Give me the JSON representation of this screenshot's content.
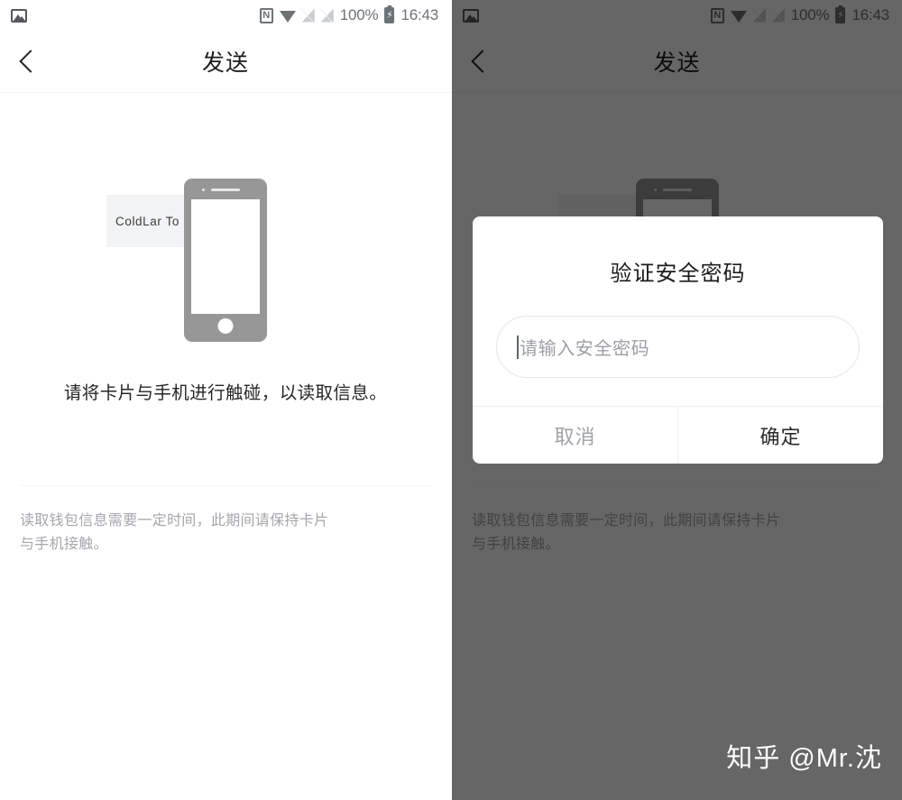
{
  "status_bar": {
    "notification_icon": "photo-icon",
    "nfc_icon": "nfc-icon",
    "nfc_glyph": "N",
    "wifi_icon": "wifi-icon",
    "signal_icon_1": "signal-no-sim-icon",
    "signal_icon_2": "signal-no-sim-icon",
    "battery_percent": "100%",
    "battery_icon": "battery-charging-icon",
    "battery_glyph": "⚡",
    "time": "16:43"
  },
  "header": {
    "back_icon": "back-chevron-icon",
    "title": "发送"
  },
  "main": {
    "card_label": "ColdLar To",
    "phone_illustration": "phone-illustration",
    "instruction": "请将卡片与手机进行触碰，以读取信息。",
    "footer_note": "读取钱包信息需要一定时间，此期间请保持卡片与手机接触。"
  },
  "dialog": {
    "title": "验证安全密码",
    "input_value": "",
    "input_placeholder": "请输入安全密码",
    "cancel_label": "取消",
    "confirm_label": "确定"
  },
  "watermark": {
    "text": "知乎 @Mr.沈"
  },
  "colors": {
    "background": "#ffffff",
    "title_text": "#1c1c1c",
    "body_text": "#262626",
    "muted_text": "#a3a6aa",
    "phone_body": "#979797",
    "card_bg": "#f2f3f4",
    "scrim": "#666666",
    "divider": "#eeeff1"
  }
}
